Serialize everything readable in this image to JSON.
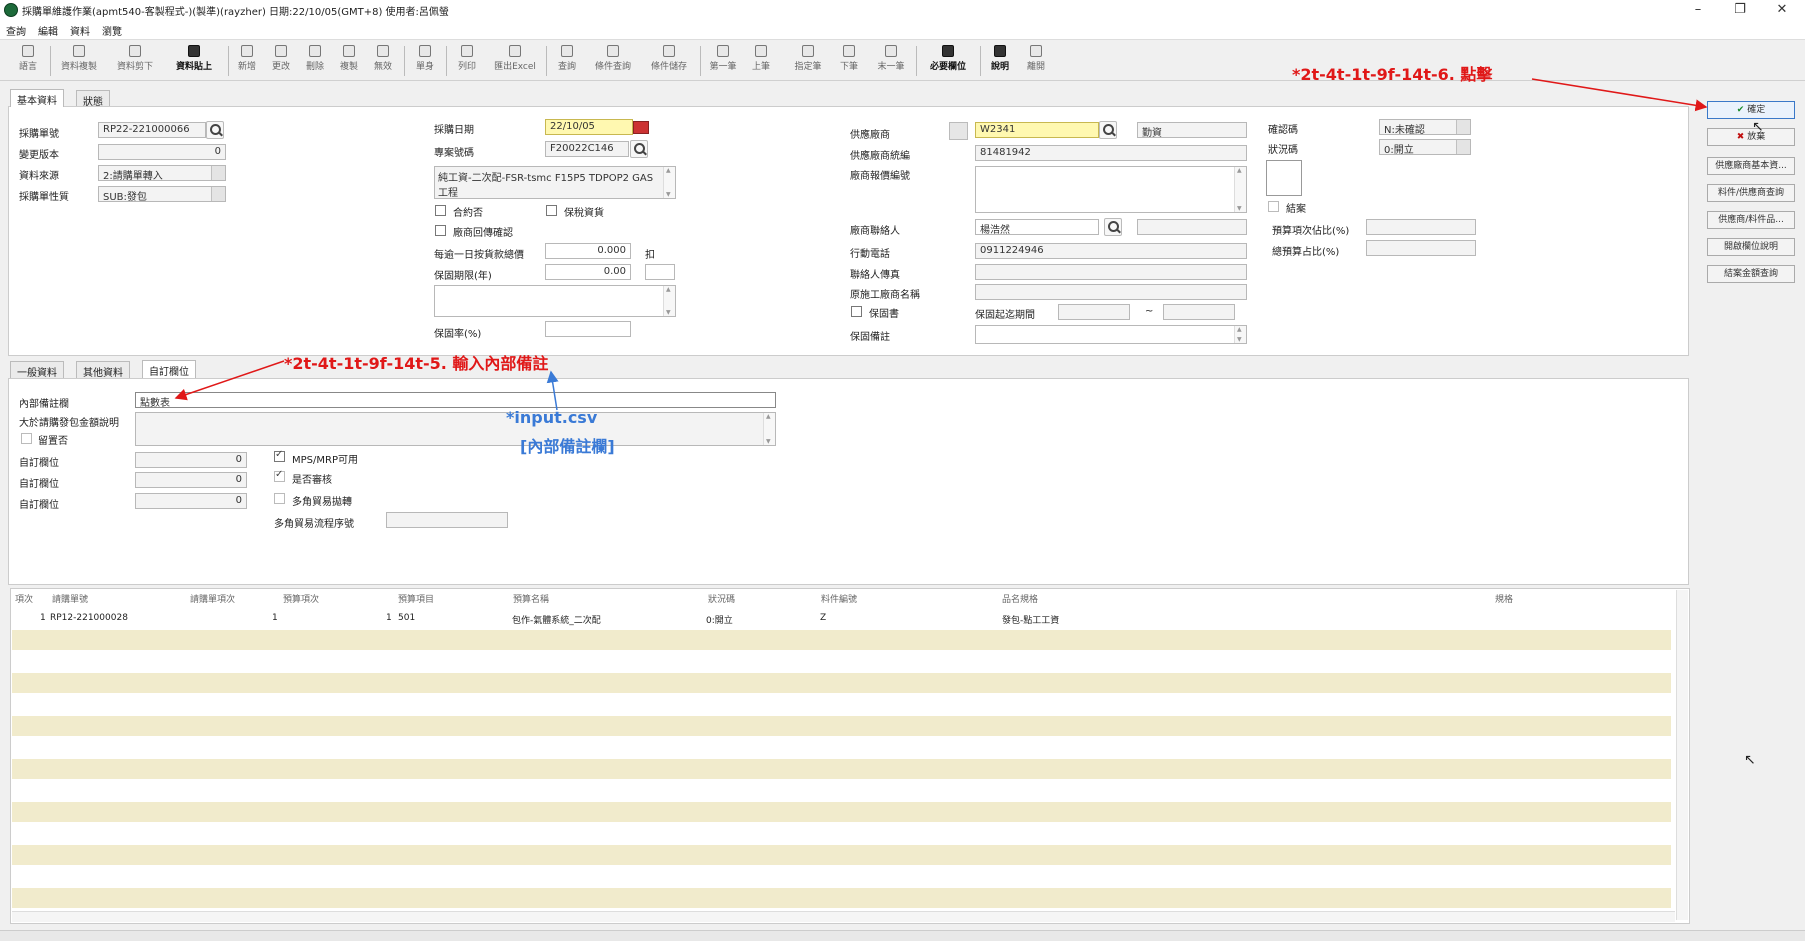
{
  "window": {
    "title": "採購單維護作業(apmt540-客製程式-)(製準)(rayzher)  日期:22/10/05(GMT+8)  使用者:呂佩螢",
    "minimize": "–",
    "restore": "❐",
    "close": "✕"
  },
  "menu": [
    "查詢",
    "編輯",
    "資料",
    "瀏覽"
  ],
  "toolbar": [
    "語言",
    "資料複製",
    "資料剪下",
    "資料貼上",
    "新增",
    "更改",
    "刪除",
    "複製",
    "無效",
    "單身",
    "列印",
    "匯出Excel",
    "查詢",
    "條件查詢",
    "條件儲存",
    "第一筆",
    "上筆",
    "指定筆",
    "下筆",
    "末一筆",
    "必要欄位",
    "說明",
    "離開"
  ],
  "tabs_top": [
    "基本資料",
    "狀態"
  ],
  "tabs_bottom": [
    "一般資料",
    "其他資料",
    "自訂欄位"
  ],
  "basic": {
    "po_no_label": "採購單號",
    "po_no": "RP22-221000066",
    "version_label": "變更版本",
    "version": "0",
    "source_label": "資料來源",
    "source": "2:請購單轉入",
    "nature_label": "採購單性質",
    "nature": "SUB:發包",
    "date_label": "採購日期",
    "date": "22/10/05",
    "project_label": "專案號碼",
    "project": "F20022C146",
    "project_desc": "純工資-二次配-FSR-tsmc F15P5 TDPOP2 GAS工程",
    "contract_label": "合約否",
    "bonded_label": "保稅資貨",
    "vendor_confirm_label": "廠商回傳確認",
    "late_fee_label": "每逾一日按貨款總價",
    "late_fee": "0.000",
    "late_fee_unit": "扣",
    "warranty_years_label": "保固期限(年)",
    "warranty_years": "0.00",
    "warranty_pct_label": "保固率(%)",
    "vendor_label": "供應廠商",
    "vendor": "W2341",
    "vendor_name": "勤資",
    "vendor_tax_label": "供應廠商統編",
    "vendor_tax": "81481942",
    "vendor_quote_label": "廠商報價編號",
    "contact_label": "廠商聯絡人",
    "contact": "楊浩然",
    "mobile_label": "行動電話",
    "mobile": "0911224946",
    "fax_label": "聯絡人傳真",
    "original_vendor_label": "原施工廠商名稱",
    "warranty_flag_label": "保固書",
    "warranty_period_label": "保固起迄期間",
    "warranty_sep": "~",
    "warranty_note_label": "保固備註",
    "confirm_code_label": "確認碼",
    "confirm_code": "N:未確認",
    "status_code_label": "狀況碼",
    "status_code": "0:開立",
    "closed_label": "結案",
    "budget_ratio_label": "預算項次佔比(%)",
    "total_budget_ratio_label": "總預算占比(%)"
  },
  "right_buttons": {
    "ok": "確定",
    "cancel": "放棄",
    "others": [
      "供應廠商基本資...",
      "料件/供應商查詢",
      "供應商/料件品...",
      "開啟欄位說明",
      "結案金額查詢"
    ]
  },
  "custom": {
    "internal_note_label": "內部備註欄",
    "internal_note": "點數表",
    "large_label": "大於請購發包金額說明",
    "hold_label": "留置否",
    "custom_fields": [
      {
        "label": "自訂欄位",
        "value": "0"
      },
      {
        "label": "自訂欄位",
        "value": "0"
      },
      {
        "label": "自訂欄位",
        "value": "0"
      }
    ],
    "mps_label": "MPS/MRP可用",
    "inspect_label": "是否審核",
    "triangle_label": "多角貿易拋轉",
    "triangle_flow_label": "多角貿易流程序號"
  },
  "annotations": {
    "step5": "*2t-4t-1t-9f-14t-5. 輸入內部備註",
    "step6": "*2t-4t-1t-9f-14t-6. 點擊",
    "input_csv": "*input.csv",
    "input_field": "[內部備註欄]"
  },
  "grid": {
    "columns": [
      "項次",
      "請購單號",
      "請購單項次",
      "預算項次",
      "預算項目",
      "預算名稱",
      "狀況碼",
      "料件編號",
      "品名規格",
      "規格"
    ],
    "rows": [
      [
        "1",
        "RP12-221000028",
        "1",
        "1",
        "501",
        "包作-氣體系統_二次配",
        "0:開立",
        "Z",
        "發包-點工工資",
        ""
      ]
    ]
  },
  "colors": {
    "annotation_red": "#e01818",
    "annotation_blue": "#3a7ad6",
    "required_yellow": "#fff8b0",
    "row_stripe": "#f1ebcc"
  }
}
